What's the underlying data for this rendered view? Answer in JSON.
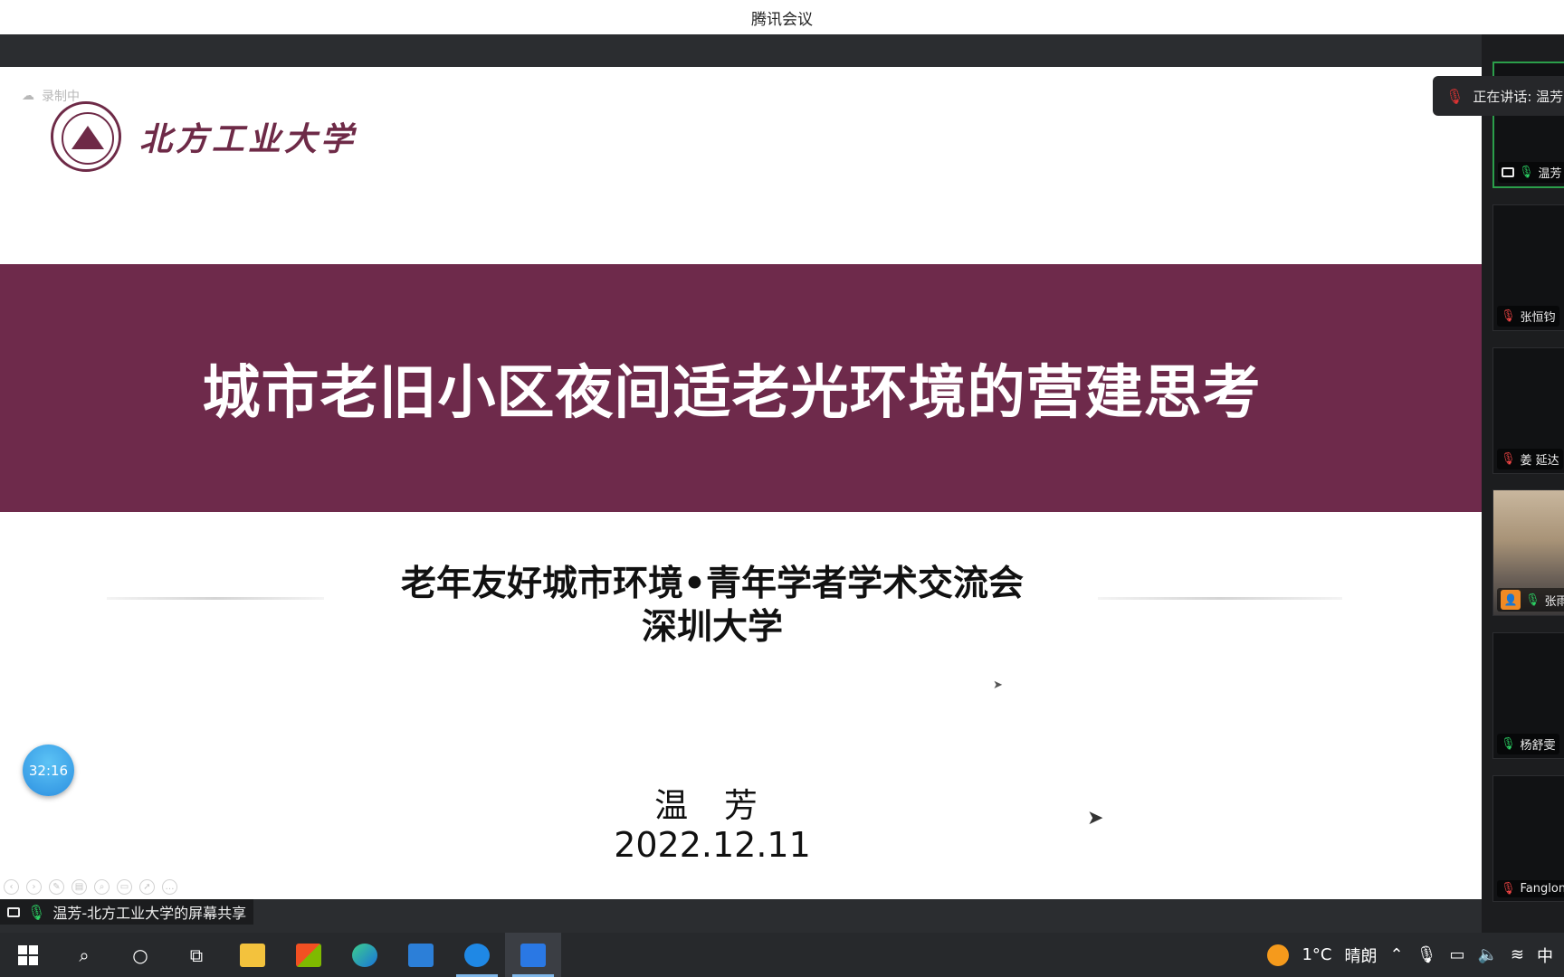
{
  "window": {
    "title": "腾讯会议"
  },
  "recording": {
    "label": "录制中"
  },
  "slide": {
    "logo_text": "北方工业大学",
    "title": "城市老旧小区夜间适老光环境的营建思考",
    "subtitle_line1": "老年友好城市环境•青年学者学术交流会",
    "subtitle_line2": "深圳大学",
    "author": "温 芳",
    "date": "2022.12.11"
  },
  "timer": {
    "value": "32:16"
  },
  "speaking": {
    "label": "正在讲话: 温芳"
  },
  "participants": [
    {
      "name": "温芳",
      "mic": "on",
      "sharing": true
    },
    {
      "name": "张恒钧",
      "mic": "off"
    },
    {
      "name": "姜 延达",
      "mic": "off"
    },
    {
      "name": "张雨",
      "mic": "on",
      "video": true
    },
    {
      "name": "杨舒雯",
      "mic": "on"
    },
    {
      "name": "Fanglon",
      "mic": "off"
    }
  ],
  "share_status": {
    "label": "温芳-北方工业大学的屏幕共享"
  },
  "taskbar": {
    "weather_temp": "1°C",
    "weather_desc": "晴朗",
    "ime": "中"
  },
  "colors": {
    "brand": "#6e2a4b",
    "accent": "#2b9e4a"
  }
}
